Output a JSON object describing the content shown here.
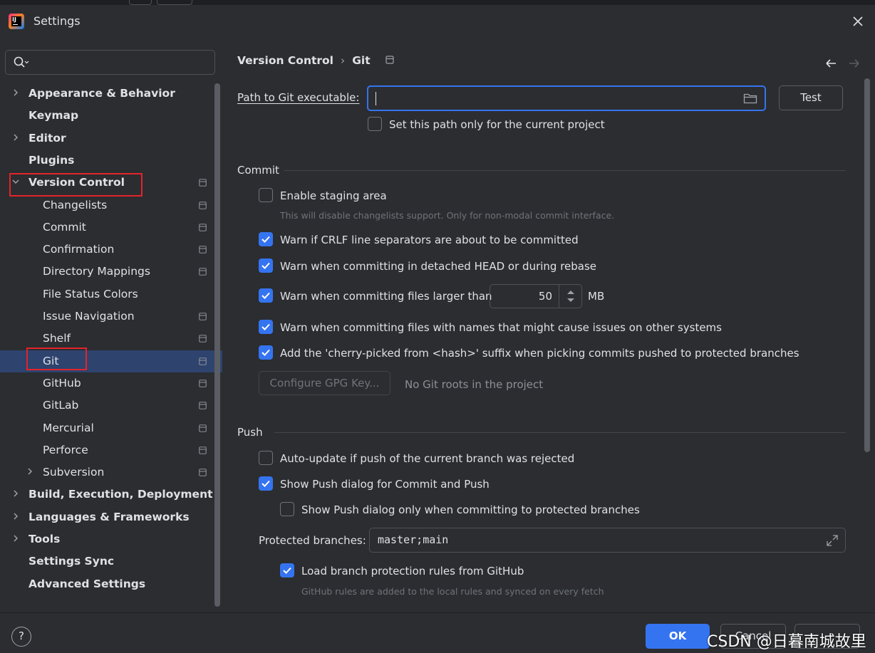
{
  "window": {
    "title": "Settings"
  },
  "sidebar": {
    "search_placeholder": "",
    "items": [
      {
        "label": "Appearance & Behavior",
        "level": 0,
        "expandable": true,
        "expanded": false,
        "bold": true
      },
      {
        "label": "Keymap",
        "level": 0,
        "expandable": false,
        "bold": true
      },
      {
        "label": "Editor",
        "level": 0,
        "expandable": true,
        "expanded": false,
        "bold": true
      },
      {
        "label": "Plugins",
        "level": 0,
        "expandable": false,
        "bold": true
      },
      {
        "label": "Version Control",
        "level": 0,
        "expandable": true,
        "expanded": true,
        "bold": true,
        "highlighted": true
      },
      {
        "label": "Changelists",
        "level": 1
      },
      {
        "label": "Commit",
        "level": 1
      },
      {
        "label": "Confirmation",
        "level": 1
      },
      {
        "label": "Directory Mappings",
        "level": 1
      },
      {
        "label": "File Status Colors",
        "level": 1
      },
      {
        "label": "Issue Navigation",
        "level": 1
      },
      {
        "label": "Shelf",
        "level": 1
      },
      {
        "label": "Git",
        "level": 1,
        "selected": true,
        "highlighted": true
      },
      {
        "label": "GitHub",
        "level": 1
      },
      {
        "label": "GitLab",
        "level": 1
      },
      {
        "label": "Mercurial",
        "level": 1
      },
      {
        "label": "Perforce",
        "level": 1
      },
      {
        "label": "Subversion",
        "level": 1,
        "expandable": true,
        "expanded": false
      },
      {
        "label": "Build, Execution, Deployment",
        "level": 0,
        "expandable": true,
        "expanded": false,
        "bold": true
      },
      {
        "label": "Languages & Frameworks",
        "level": 0,
        "expandable": true,
        "expanded": false,
        "bold": true
      },
      {
        "label": "Tools",
        "level": 0,
        "expandable": true,
        "expanded": false,
        "bold": true
      },
      {
        "label": "Settings Sync",
        "level": 0,
        "expandable": false,
        "bold": true
      },
      {
        "label": "Advanced Settings",
        "level": 0,
        "expandable": false,
        "bold": true
      }
    ]
  },
  "breadcrumb": {
    "parent": "Version Control",
    "separator": "›",
    "current": "Git"
  },
  "git": {
    "path_label": "Path to Git executable:",
    "path_value": "",
    "test_button": "Test",
    "path_current_project_only": {
      "label": "Set this path only for the current project",
      "checked": false
    }
  },
  "commit": {
    "heading": "Commit",
    "enable_staging": {
      "label": "Enable staging area",
      "checked": false,
      "hint": "This will disable changelists support. Only for non-modal commit interface."
    },
    "warn_crlf": {
      "label": "Warn if CRLF line separators are about to be committed",
      "checked": true
    },
    "warn_detached": {
      "label": "Warn when committing in detached HEAD or during rebase",
      "checked": true
    },
    "warn_large": {
      "label": "Warn when committing files larger than",
      "checked": true,
      "value": "50",
      "unit": "MB"
    },
    "warn_names": {
      "label": "Warn when committing files with names that might cause issues on other systems",
      "checked": true
    },
    "cherry_pick": {
      "label": "Add the 'cherry-picked from <hash>' suffix when picking commits pushed to protected branches",
      "checked": true
    },
    "gpg_button": "Configure GPG Key...",
    "gpg_status": "No Git roots in the project"
  },
  "push": {
    "heading": "Push",
    "auto_update": {
      "label": "Auto-update if push of the current branch was rejected",
      "checked": false
    },
    "show_push_dialog": {
      "label": "Show Push dialog for Commit and Push",
      "checked": true
    },
    "show_push_protected": {
      "label": "Show Push dialog only when committing to protected branches",
      "checked": false
    },
    "protected_label": "Protected branches:",
    "protected_value": "master;main",
    "load_github_rules": {
      "label": "Load branch protection rules from GitHub",
      "checked": true,
      "hint": "GitHub rules are added to the local rules and synced on every fetch"
    }
  },
  "footer": {
    "help": "?",
    "ok": "OK",
    "cancel": "Cancel",
    "watermark": "CSDN @日暮南城故里"
  },
  "colors": {
    "accent": "#3574f0",
    "highlight_box": "#e3242b",
    "selection": "#2e436e",
    "background": "#2b2d30"
  }
}
